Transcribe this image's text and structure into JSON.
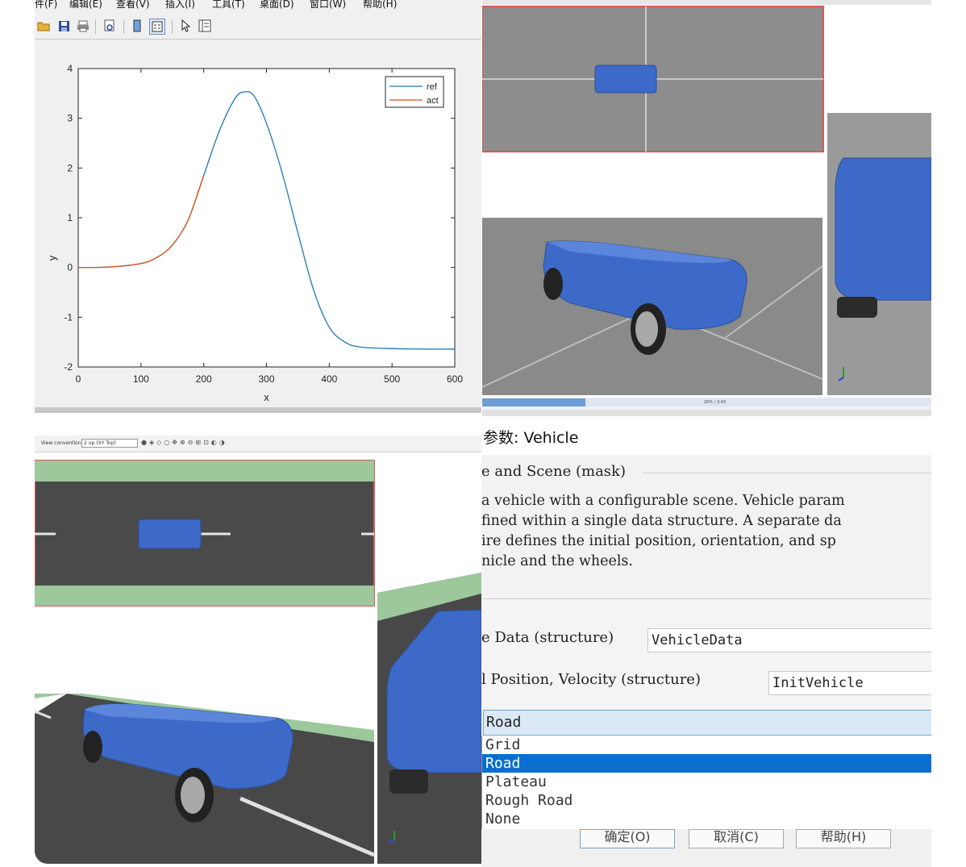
{
  "figure": {
    "menu": [
      "件(F)",
      "编辑(E)",
      "查看(V)",
      "插入(I)",
      "工具(T)",
      "桌面(D)",
      "窗口(W)",
      "帮助(H)"
    ],
    "toolbar_icons": [
      "open-file-icon",
      "save-icon",
      "print-icon",
      "print-preview-icon",
      "colorbar-icon",
      "legend-icon",
      "pointer-icon",
      "property-editor-icon"
    ]
  },
  "chart_data": {
    "type": "line",
    "xlabel": "x",
    "ylabel": "y",
    "xlim": [
      0,
      600
    ],
    "ylim": [
      -2,
      4
    ],
    "x_ticks": [
      0,
      100,
      200,
      300,
      400,
      500,
      600
    ],
    "y_ticks": [
      4,
      3,
      2,
      1,
      0,
      -1,
      -2
    ],
    "grid": false,
    "legend_position": "top-right",
    "series": [
      {
        "name": "ref",
        "color": "#1f77b4"
      },
      {
        "name": "act",
        "color": "#d95319"
      }
    ],
    "curve": {
      "x": [
        0,
        50,
        100,
        125,
        150,
        175,
        200,
        225,
        250,
        265,
        280,
        300,
        325,
        350,
        375,
        400,
        425,
        450,
        500,
        550,
        600
      ],
      "y": [
        0.0,
        0.01,
        0.08,
        0.2,
        0.45,
        0.95,
        1.85,
        2.75,
        3.4,
        3.53,
        3.45,
        2.9,
        1.9,
        0.7,
        -0.45,
        -1.2,
        -1.5,
        -1.6,
        -1.63,
        -1.64,
        -1.64
      ]
    },
    "act_visible_until_x": 215
  },
  "viewer_top": {
    "status_text": "20% / 3.43"
  },
  "viewer_bottom": {
    "toolbar_label": "View convention",
    "toolbar_value": "2 up (XY Top)"
  },
  "dialog": {
    "title": "参数: Vehicle",
    "group_title": "e and Scene (mask)",
    "description": [
      " a vehicle with a configurable scene.  Vehicle param",
      "fined within a single data structure.  A separate da",
      "ire defines the initial position, orientation, and sp",
      "nicle and the wheels."
    ],
    "params": [
      {
        "label": "e Data (structure)",
        "value": "VehicleData"
      },
      {
        "label": "l Position, Velocity (structure)",
        "value": "InitVehicle"
      }
    ],
    "scene_selected": "Road",
    "scene_options": [
      "Grid",
      "Road",
      "Plateau",
      "Rough Road",
      "None"
    ],
    "buttons": [
      "确定(O)",
      "取消(C)",
      "帮助(H)"
    ]
  },
  "colors": {
    "vehicle_blue": "#3d6ac8",
    "ground_gray": "#8b8b8b",
    "road_dark": "#4a4a4a",
    "grass_green": "#9cc89c",
    "selection_blue": "#0a6fd0"
  }
}
